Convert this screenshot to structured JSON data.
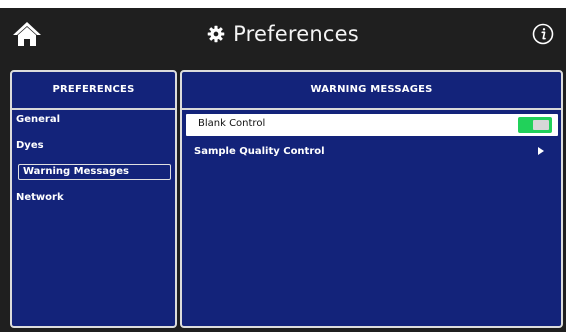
{
  "app": {
    "title": "Preferences"
  },
  "icons": {
    "home": "home-icon",
    "gear": "gear-icon",
    "info": "info-icon",
    "arrow": "chevron-right-icon"
  },
  "left_panel": {
    "header": "PREFERENCES",
    "items": [
      {
        "label": "General",
        "active": false
      },
      {
        "label": "Dyes",
        "active": false
      },
      {
        "label": "Warning Messages",
        "active": true
      },
      {
        "label": "Network",
        "active": false
      }
    ]
  },
  "right_panel": {
    "header": "WARNING MESSAGES",
    "rows": [
      {
        "label": "Blank Control",
        "toggle": true
      },
      {
        "label": "Sample Quality Control",
        "submenu": true
      }
    ]
  },
  "colors": {
    "panel_bg": "#13237a",
    "toggle_on": "#21d15a",
    "topbar_bg": "#1f1f1f"
  }
}
